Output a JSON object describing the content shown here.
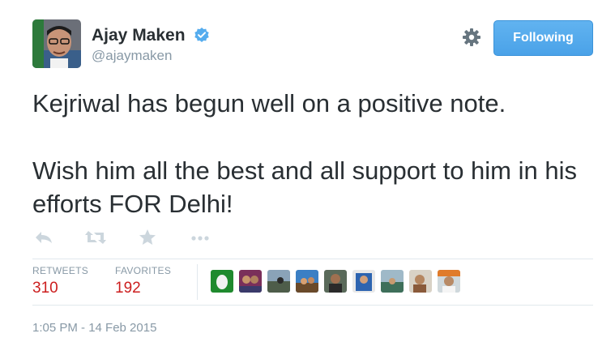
{
  "author": {
    "name": "Ajay Maken",
    "handle": "@ajaymaken",
    "verified_icon": "verified-badge-icon"
  },
  "header": {
    "follow_button_label": "Following",
    "settings_icon": "gear-icon"
  },
  "tweet": {
    "paragraphs": [
      "Kejriwal has begun well on a positive note.",
      "Wish him all the best and all support to him in his efforts FOR Delhi!"
    ]
  },
  "actions": [
    "reply-icon",
    "retweet-icon",
    "favorite-icon",
    "more-icon"
  ],
  "stats": {
    "retweets_label": "RETWEETS",
    "retweets_value": "310",
    "favorites_label": "FAVORITES",
    "favorites_value": "192"
  },
  "timestamp": "1:05 PM - 14 Feb 2015",
  "colors": {
    "follow_button": "#55acee",
    "stat_value": "#cc1e1e",
    "muted": "#8899a6"
  }
}
